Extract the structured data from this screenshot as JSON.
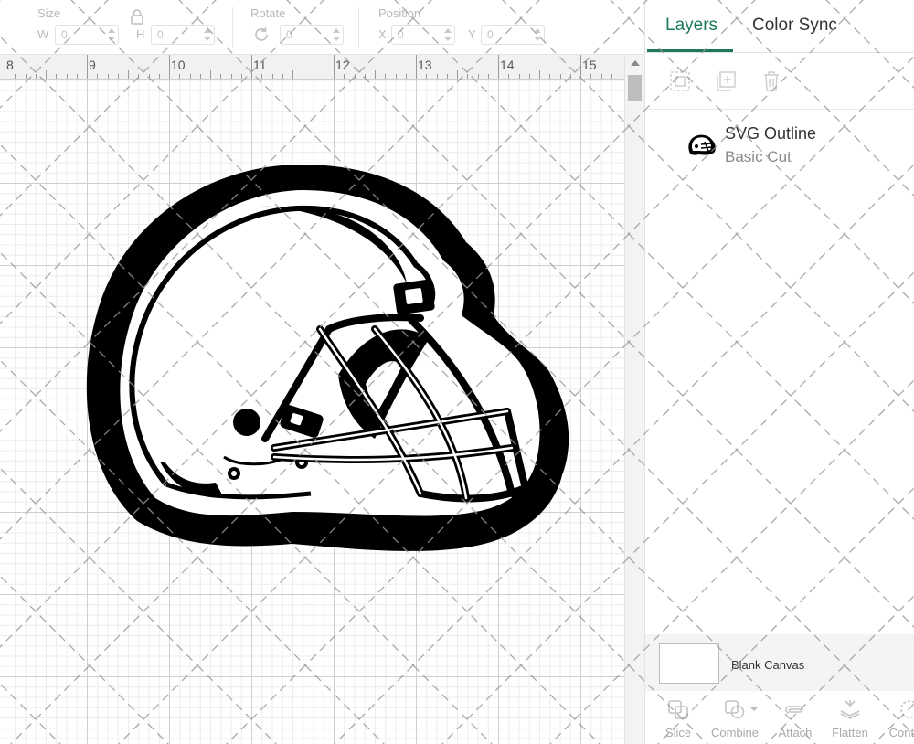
{
  "toolbar": {
    "size_label": "Size",
    "width_prefix": "W",
    "width_value": "0",
    "height_prefix": "H",
    "height_value": "0",
    "rotate_label": "Rotate",
    "rotate_value": "0",
    "position_label": "Position",
    "x_prefix": "X",
    "x_value": "0",
    "y_prefix": "Y",
    "y_value": "0"
  },
  "ruler": {
    "numbers": [
      "8",
      "9",
      "10",
      "11",
      "12",
      "13",
      "14",
      "15"
    ]
  },
  "panel": {
    "tabs": [
      {
        "label": "Layers",
        "active": true
      },
      {
        "label": "Color Sync",
        "active": false
      }
    ],
    "icon_buttons": [
      "group-icon",
      "duplicate-icon",
      "delete-icon"
    ],
    "layers": [
      {
        "name": "SVG Outline",
        "operation": "Basic Cut",
        "icon": "helmet-icon"
      }
    ],
    "blank_canvas_label": "Blank Canvas",
    "actions": [
      {
        "label": "Slice",
        "icon": "slice-icon"
      },
      {
        "label": "Combine",
        "icon": "combine-icon"
      },
      {
        "label": "Attach",
        "icon": "attach-icon"
      },
      {
        "label": "Flatten",
        "icon": "flatten-icon"
      },
      {
        "label": "Conto",
        "icon": "contour-icon"
      }
    ]
  },
  "colors": {
    "accent": "#1d7a58",
    "artwork": "#000000"
  }
}
